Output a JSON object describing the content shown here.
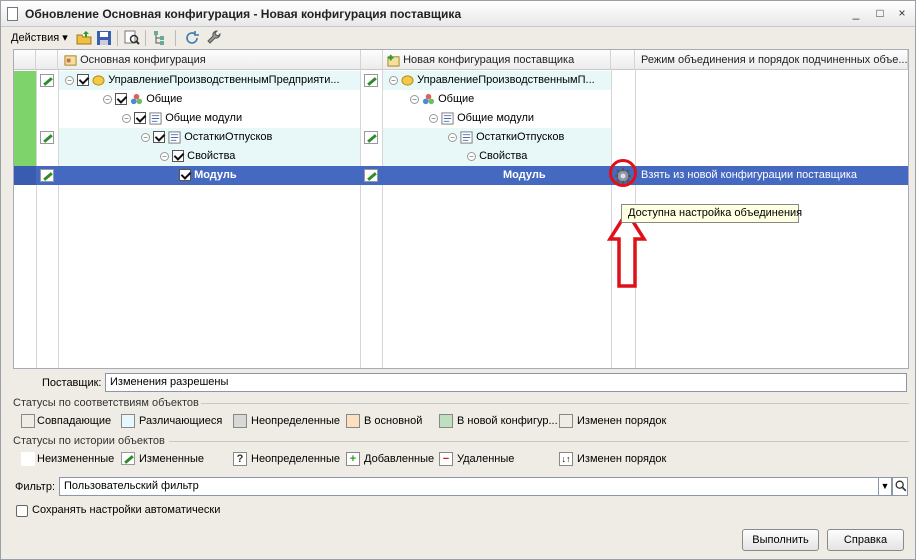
{
  "window": {
    "title": "Обновление Основная конфигурация - Новая конфигурация поставщика",
    "controls": [
      "_",
      "□",
      "×"
    ]
  },
  "toolbar": {
    "actions_label": "Действия"
  },
  "columns": {
    "main": "Основная конфигурация",
    "supplier": "Новая конфигурация поставщика",
    "mode": "Режим объединения и порядок подчиненных объе..."
  },
  "tree": {
    "rows": [
      {
        "main": "УправлениеПроизводственнымПредприяти...",
        "supplier": "УправлениеПроизводственнымП...",
        "mode": ""
      },
      {
        "main": "Общие",
        "supplier": "Общие",
        "mode": ""
      },
      {
        "main": "Общие модули",
        "supplier": "Общие модули",
        "mode": ""
      },
      {
        "main": "ОстаткиОтпусков",
        "supplier": "ОстаткиОтпусков",
        "mode": ""
      },
      {
        "main": "Свойства",
        "supplier": "Свойства",
        "mode": ""
      },
      {
        "main": "Модуль",
        "supplier": "Модуль",
        "mode": "Взять из новой конфигурации поставщика"
      }
    ],
    "tooltip": "Доступна настройка объединения"
  },
  "supplier": {
    "label": "Поставщик:",
    "value": "Изменения разрешены"
  },
  "legend_match": {
    "title": "Статусы по соответствиям объектов",
    "items": [
      {
        "label": "Совпадающие",
        "color": "#ffffff"
      },
      {
        "label": "Различающиеся",
        "color": "#e6f8fb"
      },
      {
        "label": "Неопределенные",
        "color": "#d8d8d8"
      },
      {
        "label": "В основной",
        "color": "#fde0c0"
      },
      {
        "label": "В новой конфигур...",
        "color": "#bfe0bf"
      },
      {
        "label": "Изменен порядок",
        "color": "#ffffff"
      }
    ]
  },
  "legend_history": {
    "title": "Статусы по истории объектов",
    "items": [
      {
        "label": "Неизмененные",
        "icon": "blank-icon"
      },
      {
        "label": "Измененные",
        "icon": "pencil-icon"
      },
      {
        "label": "Неопределенные",
        "icon": "question-icon"
      },
      {
        "label": "Добавленные",
        "icon": "plus-icon"
      },
      {
        "label": "Удаленные",
        "icon": "minus-icon"
      },
      {
        "label": "Изменен порядок",
        "icon": "order-icon"
      }
    ]
  },
  "filter": {
    "label": "Фильтр:",
    "value": "Пользовательский фильтр"
  },
  "autosave": {
    "label": "Сохранять настройки автоматически"
  },
  "buttons": {
    "run": "Выполнить",
    "help": "Справка"
  }
}
